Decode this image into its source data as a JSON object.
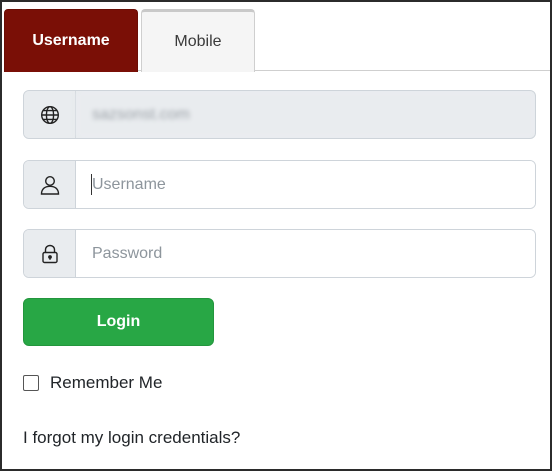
{
  "tabs": [
    {
      "label": "Username",
      "active": true
    },
    {
      "label": "Mobile",
      "active": false
    }
  ],
  "domain": {
    "value": "sazsonst.com",
    "icon": "globe-icon"
  },
  "username": {
    "placeholder": "Username",
    "icon": "user-icon"
  },
  "password": {
    "placeholder": "Password",
    "icon": "lock-icon"
  },
  "login_button": {
    "label": "Login"
  },
  "remember_me": {
    "label": "Remember Me",
    "checked": false
  },
  "forgot_link": {
    "label": "I forgot my login credentials?"
  },
  "colors": {
    "active_tab": "#7a0f06",
    "login_button": "#28a745",
    "addon_bg": "#e9ecef"
  }
}
